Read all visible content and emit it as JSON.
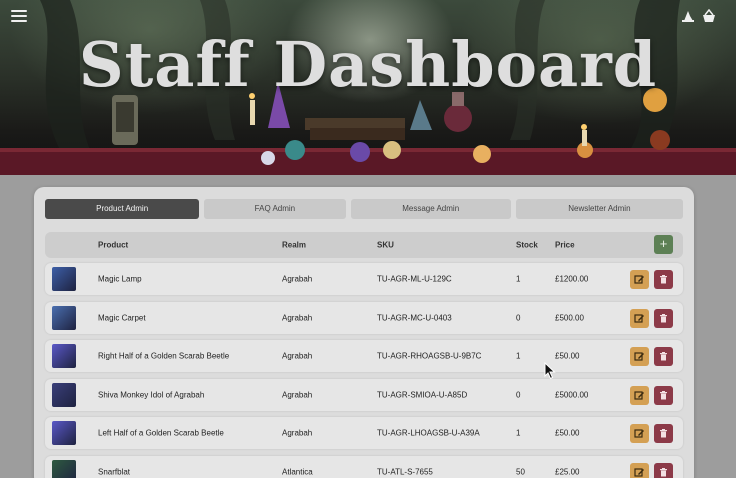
{
  "header": {
    "title": "Staff Dashboard",
    "menu_icon": "hamburger-menu-icon",
    "right_icons": [
      "wizard-hat-icon",
      "basket-icon"
    ]
  },
  "tabs": [
    {
      "label": "Product Admin",
      "active": true
    },
    {
      "label": "FAQ Admin",
      "active": false
    },
    {
      "label": "Message Admin",
      "active": false
    },
    {
      "label": "Newsletter Admin",
      "active": false
    }
  ],
  "table": {
    "columns": {
      "product": "Product",
      "realm": "Realm",
      "sku": "SKU",
      "stock": "Stock",
      "price": "Price"
    },
    "add_button": "+",
    "rows": [
      {
        "product": "Magic Lamp",
        "realm": "Agrabah",
        "sku": "TU-AGR-ML-U-129C",
        "stock": "1",
        "price": "£1200.00",
        "thumb_color": "#3d5fa8"
      },
      {
        "product": "Magic Carpet",
        "realm": "Agrabah",
        "sku": "TU-AGR-MC-U-0403",
        "stock": "0",
        "price": "£500.00",
        "thumb_color": "#4a6fb0"
      },
      {
        "product": "Right Half of a Golden Scarab Beetle",
        "realm": "Agrabah",
        "sku": "TU-AGR-RHOAGSB-U-9B7C",
        "stock": "1",
        "price": "£50.00",
        "thumb_color": "#5a58c8"
      },
      {
        "product": "Shiva Monkey Idol of Agrabah",
        "realm": "Agrabah",
        "sku": "TU-AGR-SMIOA-U-A85D",
        "stock": "0",
        "price": "£5000.00",
        "thumb_color": "#3a3f7a"
      },
      {
        "product": "Left Half of a Golden Scarab Beetle",
        "realm": "Agrabah",
        "sku": "TU-AGR-LHOAGSB-U-A39A",
        "stock": "1",
        "price": "£50.00",
        "thumb_color": "#5a58c8"
      },
      {
        "product": "Snarfblat",
        "realm": "Atlantica",
        "sku": "TU-ATL-S-7655",
        "stock": "50",
        "price": "£25.00",
        "thumb_color": "#2e5a40"
      }
    ]
  },
  "colors": {
    "accent_edit": "#d4a054",
    "accent_delete": "#8c3a48",
    "accent_add": "#5d8055",
    "active_tab": "#4a4a4a"
  }
}
